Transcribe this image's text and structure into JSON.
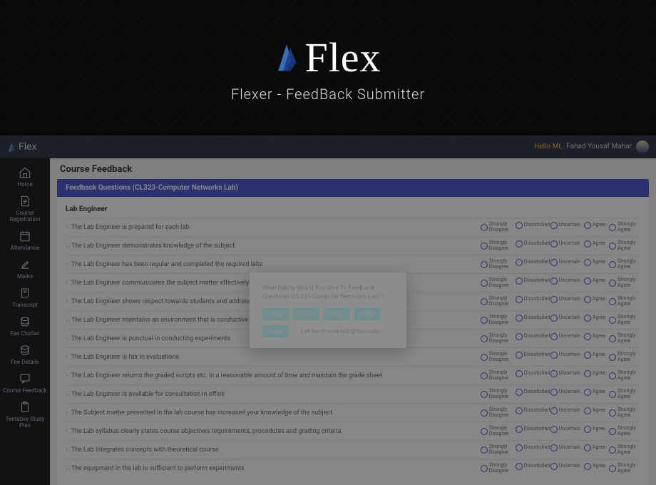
{
  "hero": {
    "brand": "Flex",
    "tagline": "Flexer - FeedBack Submitter"
  },
  "topbar": {
    "brand": "Flex",
    "hello": "Hello Mr,",
    "username": "Fahad Yousaf Mahar"
  },
  "sidebar": {
    "items": [
      {
        "label": "Home"
      },
      {
        "label": "Course Registration"
      },
      {
        "label": "Attendance"
      },
      {
        "label": "Marks"
      },
      {
        "label": "Transcript"
      },
      {
        "label": "Fee Challan"
      },
      {
        "label": "Fee Details"
      },
      {
        "label": "Course Feedback"
      },
      {
        "label": "Tentative Study Plan"
      }
    ]
  },
  "main": {
    "title": "Course Feedback",
    "panel_title": "Feedback Questions (CL323-Computer Networks Lab)",
    "section": "Lab Engineer",
    "questions": [
      "The Lab Engineer is prepared for each lab",
      "The Lab Engineer demonstrates knowledge of the subject",
      "The Lab Engineer has been regular and completed the required labs",
      "The Lab Engineer communicates the subject matter effectively",
      "The Lab Engineer shows respect towards students and addresses lab related queries",
      "The Lab Engineer maintains an environment that is conductive to learning",
      "The Lab Engineer is punctual in conducting experiments",
      "The Lab Engineer is fair in evaluations",
      "The Lab Engineer returns the graded scripts etc. in a reasonable amount of time and maintain the grade sheet",
      "The Lab Engineer is available for consultation in office",
      "The Subject matter presented in the lab course has increased your knowledge of the subject",
      "The Lab syllabus clearly states course objectives requirements, procedures and grading criteria",
      "The Lab integrates concepts with theoretical course",
      "The equipment in the lab is sufficient to perform experiments"
    ],
    "options": [
      "Strongly Disagree",
      "Dissatisfied",
      "Uncertain",
      "Agree",
      "Strongly Agree"
    ]
  },
  "modal": {
    "question": "What Rating Would You Give To Feedback Questions (CL323-Computer Networks Lab) ?",
    "stars": [
      "1 Star",
      "2 Star",
      "3 Star",
      "4 Star",
      "5 Star"
    ],
    "manual": "Let me choose rating manually !"
  }
}
